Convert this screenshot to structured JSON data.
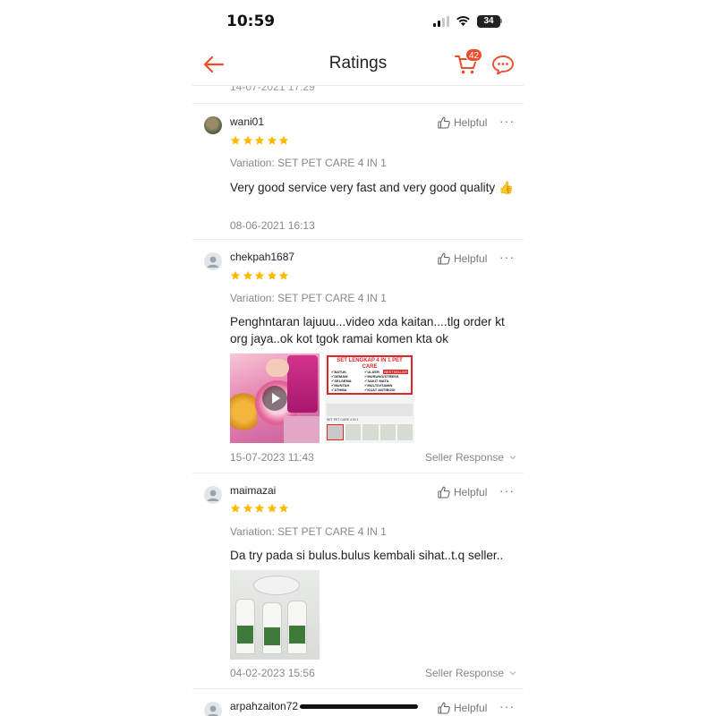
{
  "status_bar": {
    "time": "10:59",
    "battery": "34"
  },
  "header": {
    "title": "Ratings",
    "cart_count": "42"
  },
  "previous_review_date": "14-07-2021 17:29",
  "helpful_label": "Helpful",
  "more_label": "···",
  "reviews": [
    {
      "username": "wani01",
      "stars": 5,
      "variation": "Variation: SET PET CARE 4 IN 1",
      "comment": "Very good service very fast and very good quality 👍",
      "date": "08-06-2021 16:13"
    },
    {
      "username": "chekpah1687",
      "stars": 5,
      "variation": "Variation: SET PET CARE 4 IN 1",
      "comment": "Penghntaran lajuuu...video xda kaitan....tlg order kt org jaya..ok kot tgok ramai komen kta ok",
      "date": "15-07-2023 11:43",
      "seller_response": "Seller Response",
      "media_poster": {
        "title": "SET LENGKAP 4 IN 1 PET CARE",
        "bestseller": "BESTSELLER",
        "col1": [
          "✔BATUK",
          "✔DEMAM",
          "✔SELSEMA",
          "✔MUNTAH",
          "✔ATHMA"
        ],
        "col2": [
          "✔ULSER",
          "✔MURUNG/STRESS",
          "✔SAKIT MATA",
          "✔MULTIVITAMIN",
          "✔KUAT ANTIBODI"
        ],
        "caption": "SET PET CARE 4 IN 1"
      }
    },
    {
      "username": "maimazai",
      "stars": 5,
      "variation": "Variation: SET PET CARE 4 IN 1",
      "comment": "Da try pada si bulus.bulus kembali sihat..t.q seller..",
      "date": "04-02-2023 15:56",
      "seller_response": "Seller Response"
    },
    {
      "username": "arpahzaiton72"
    }
  ],
  "colors": {
    "accent": "#ee4d2d",
    "star": "#ffb800",
    "muted": "#888888"
  }
}
